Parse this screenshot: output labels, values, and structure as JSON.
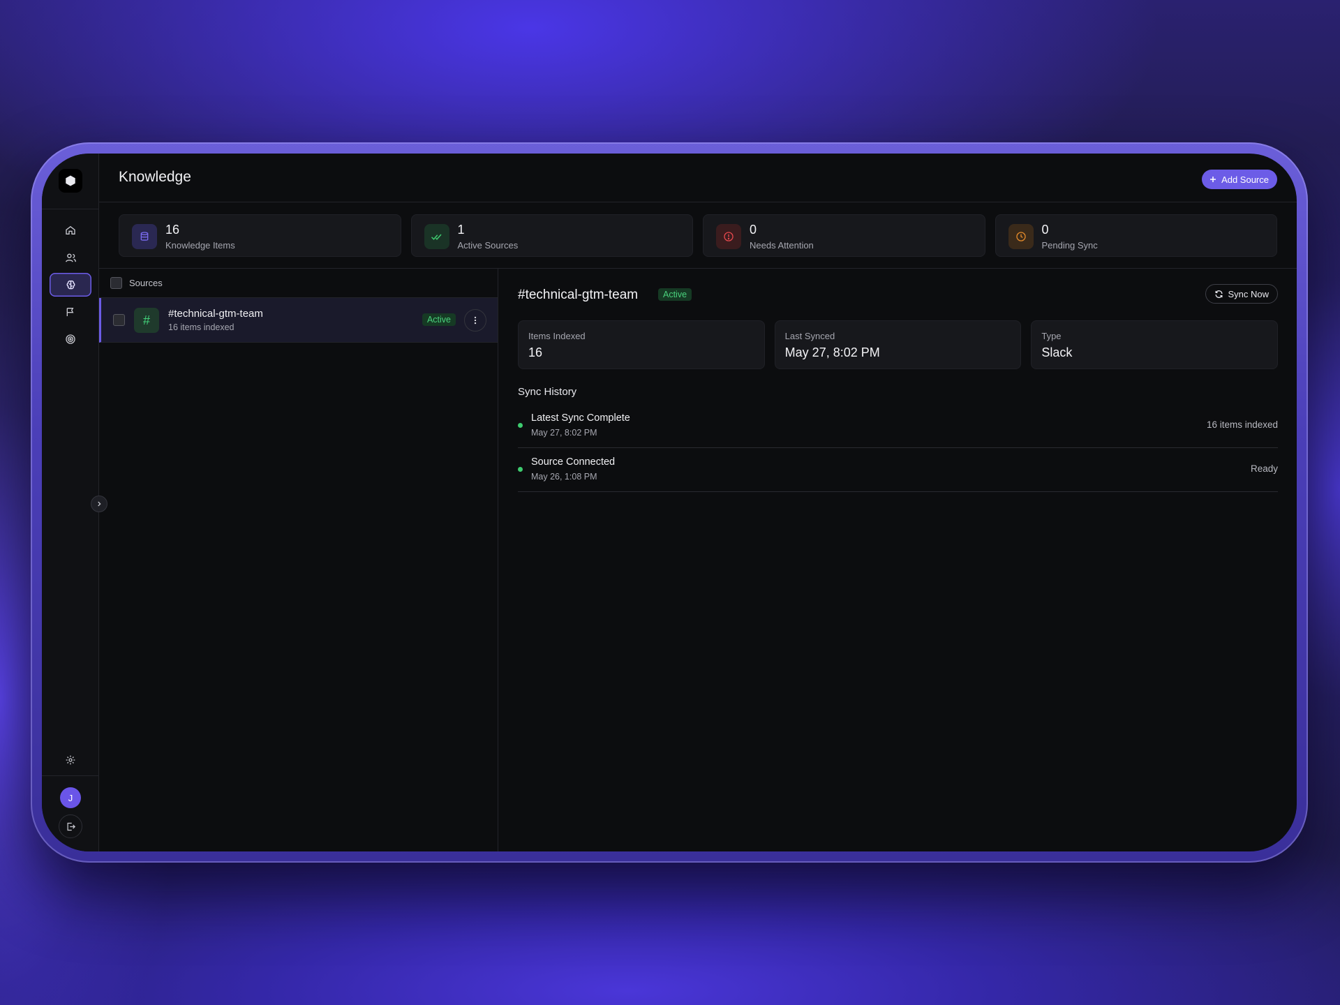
{
  "app": {
    "page_title": "Knowledge",
    "user_initial": "J"
  },
  "header": {
    "add_source_label": "Add Source"
  },
  "stats": [
    {
      "value": "16",
      "label": "Knowledge Items",
      "icon": "database-icon",
      "color": "#7b6cf0"
    },
    {
      "value": "1",
      "label": "Active Sources",
      "icon": "double-check-icon",
      "color": "#3ecb6f"
    },
    {
      "value": "0",
      "label": "Needs Attention",
      "icon": "alert-circle-icon",
      "color": "#e5484d"
    },
    {
      "value": "0",
      "label": "Pending Sync",
      "icon": "clock-icon",
      "color": "#e38a2a"
    }
  ],
  "sources": {
    "header_label": "Sources",
    "items": [
      {
        "name": "#technical-gtm-team",
        "subtitle": "16 items indexed",
        "status": "Active"
      }
    ]
  },
  "detail": {
    "title": "#technical-gtm-team",
    "status": "Active",
    "sync_button_label": "Sync Now",
    "cards": [
      {
        "label": "Items Indexed",
        "value": "16"
      },
      {
        "label": "Last Synced",
        "value": "May 27, 8:02 PM"
      },
      {
        "label": "Type",
        "value": "Slack"
      }
    ],
    "history_title": "Sync History",
    "history": [
      {
        "name": "Latest Sync Complete",
        "time": "May 27, 8:02 PM",
        "status": "16 items indexed"
      },
      {
        "name": "Source Connected",
        "time": "May 26, 1:08 PM",
        "status": "Ready"
      }
    ]
  },
  "colors": {
    "accent": "#6c5ce7",
    "success": "#3ecb6f"
  }
}
